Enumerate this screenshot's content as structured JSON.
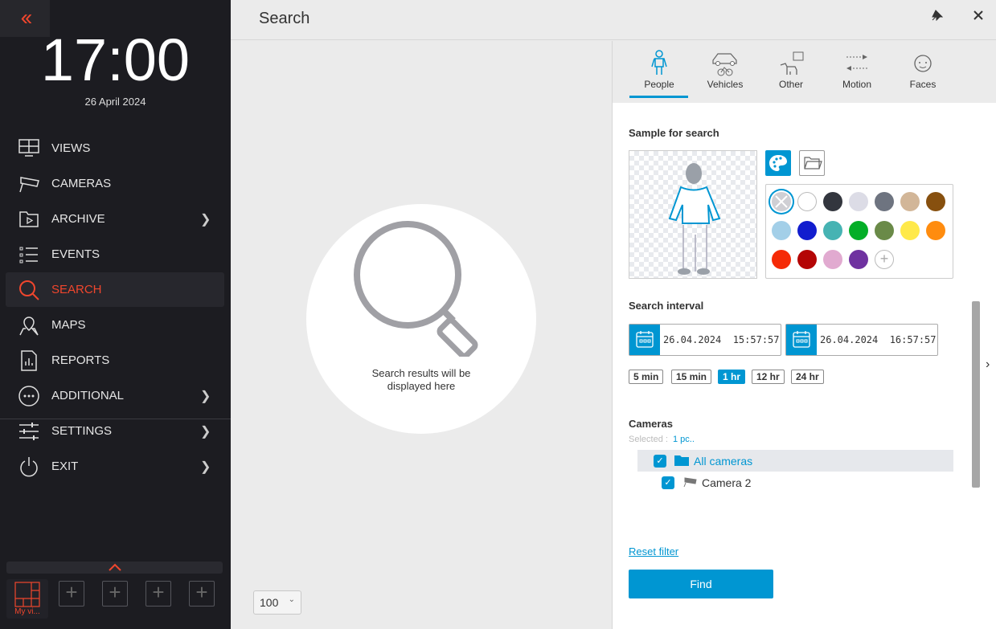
{
  "sidebar": {
    "collapse_icon": "double-chevron-left-icon",
    "time": "17:00",
    "date": "26 April 2024",
    "items": [
      {
        "label": "VIEWS",
        "icon": "views-icon",
        "has_submenu": false
      },
      {
        "label": "CAMERAS",
        "icon": "camera-icon",
        "has_submenu": false
      },
      {
        "label": "ARCHIVE",
        "icon": "archive-icon",
        "has_submenu": true
      },
      {
        "label": "EVENTS",
        "icon": "events-icon",
        "has_submenu": false
      },
      {
        "label": "SEARCH",
        "icon": "search-icon",
        "has_submenu": false,
        "active": true
      },
      {
        "label": "MAPS",
        "icon": "map-icon",
        "has_submenu": false
      },
      {
        "label": "REPORTS",
        "icon": "reports-icon",
        "has_submenu": false
      },
      {
        "label": "ADDITIONAL",
        "icon": "more-icon",
        "has_submenu": true
      },
      {
        "label": "SETTINGS",
        "icon": "settings-icon",
        "has_submenu": true
      },
      {
        "label": "EXIT",
        "icon": "power-icon",
        "has_submenu": true
      }
    ],
    "my_view_label": "My vi..."
  },
  "header": {
    "title": "Search"
  },
  "main": {
    "empty_text": "Search results will be displayed here",
    "page_size": "100"
  },
  "panel": {
    "tabs": [
      {
        "label": "People",
        "active": true
      },
      {
        "label": "Vehicles"
      },
      {
        "label": "Other"
      },
      {
        "label": "Motion"
      },
      {
        "label": "Faces"
      }
    ],
    "sample_title": "Sample for search",
    "colors": [
      "#ffffff",
      "#33363e",
      "#dcdce6",
      "#6e7480",
      "#d2b698",
      "#87500f",
      "#a3cfe8",
      "#121dce",
      "#46b3b3",
      "#03ae27",
      "#6a8a48",
      "#ffe94a",
      "#ff8c0f",
      "#f52a06",
      "#b40505",
      "#e1aad0",
      "#6f32a0"
    ],
    "interval_title": "Search interval",
    "from": {
      "date": "26.04.2024",
      "time": "15:57:57"
    },
    "to": {
      "date": "26.04.2024",
      "time": "16:57:57"
    },
    "presets": [
      {
        "label": "5 min"
      },
      {
        "label": "15 min"
      },
      {
        "label": "1 hr",
        "active": true
      },
      {
        "label": "12 hr"
      },
      {
        "label": "24 hr"
      }
    ],
    "cameras_title": "Cameras",
    "selected_label": "Selected :",
    "selected_value": "1 pc..",
    "tree": [
      {
        "label": "All cameras",
        "checked": true
      },
      {
        "label": "Camera 2",
        "checked": true
      }
    ],
    "reset_label": "Reset filter",
    "find_label": "Find"
  },
  "accent": "#0096d2",
  "sidebar_accent": "#f0462d"
}
